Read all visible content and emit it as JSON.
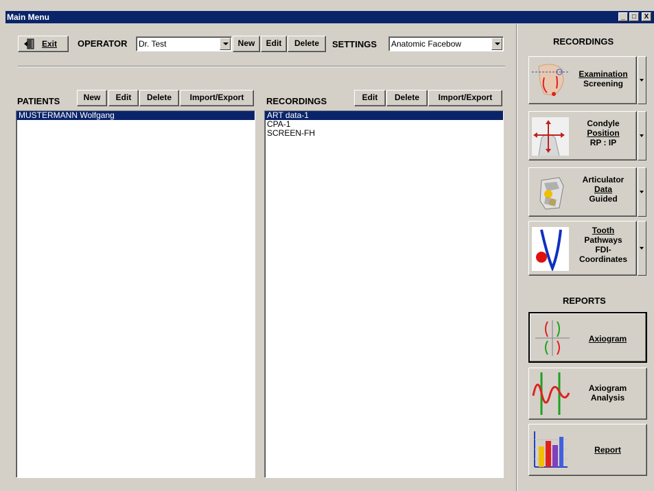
{
  "window": {
    "title": "Main Menu",
    "controls": [
      "_",
      "□",
      "X"
    ]
  },
  "toolbar": {
    "exit_label": "Exit",
    "operator_label": "OPERATOR",
    "operator_value": "Dr. Test",
    "new_label": "New",
    "edit_label": "Edit",
    "delete_label": "Delete",
    "settings_label": "SETTINGS",
    "settings_value": "Anatomic Facebow"
  },
  "patients": {
    "label": "PATIENTS",
    "buttons": {
      "new": "New",
      "edit": "Edit",
      "delete": "Delete",
      "import_export": "Import/Export"
    },
    "items": [
      "MUSTERMANN Wolfgang"
    ],
    "selected_index": 0
  },
  "recordings_list": {
    "label": "RECORDINGS",
    "buttons": {
      "edit": "Edit",
      "delete": "Delete",
      "import_export": "Import/Export"
    },
    "items": [
      "ART data-1",
      "CPA-1",
      "SCREEN-FH"
    ],
    "selected_index": 0
  },
  "right_panel": {
    "recordings_heading": "RECORDINGS",
    "recording_buttons": [
      {
        "lines": [
          "Examination",
          "Screening"
        ],
        "icon": "face-screening-icon"
      },
      {
        "lines": [
          "Condyle",
          "Position",
          "RP : IP"
        ],
        "icon": "condyle-position-icon"
      },
      {
        "lines": [
          "Articulator",
          "Data",
          "Guided"
        ],
        "icon": "articulator-icon"
      },
      {
        "lines": [
          "Tooth",
          "Pathways",
          "FDI-",
          "Coordinates"
        ],
        "icon": "tooth-pathways-icon"
      }
    ],
    "reports_heading": "REPORTS",
    "report_buttons": [
      {
        "lines": [
          "Axiogram"
        ],
        "icon": "axiogram-icon"
      },
      {
        "lines": [
          "Axiogram",
          "Analysis"
        ],
        "icon": "axiogram-analysis-icon"
      },
      {
        "lines": [
          "Report"
        ],
        "icon": "report-chart-icon"
      }
    ]
  },
  "colors": {
    "selection": "#0a246a",
    "face": "#d4d0c8"
  }
}
